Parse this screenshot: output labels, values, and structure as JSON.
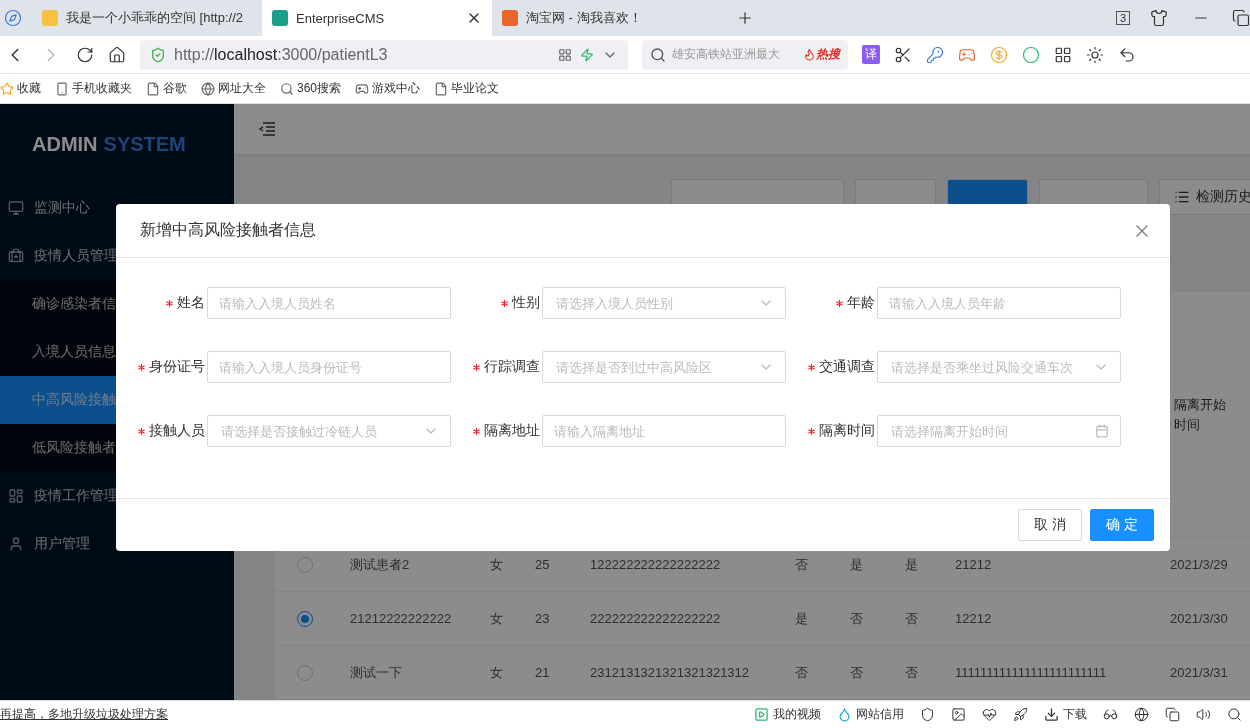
{
  "browser": {
    "tabs": [
      {
        "title": "我是一个小乖乖的空间 [http://2",
        "selected": false
      },
      {
        "title": "EnterpriseCMS",
        "selected": true
      },
      {
        "title": "淘宝网 - 淘我喜欢！",
        "selected": false
      }
    ],
    "tab_count": "3",
    "url_prefix": "http://",
    "url_host": "localhost",
    "url_rest": ":3000/patientL3",
    "search_placeholder": "雄安高铁站亚洲最大",
    "hot_search": "热搜",
    "translate": "译",
    "bookmarks": [
      "收藏",
      "手机收藏夹",
      "谷歌",
      "网址大全",
      "360搜索",
      "游戏中心",
      "毕业论文"
    ]
  },
  "app": {
    "brand": {
      "first": "ADMIN",
      "second": "SYSTEM"
    },
    "sidebar": [
      {
        "label": "监测中心",
        "selected": false
      },
      {
        "label": "疫情人员管理",
        "selected": false,
        "children": [
          {
            "label": "确诊感染者信",
            "selected": false
          },
          {
            "label": "入境人员信息",
            "selected": false
          },
          {
            "label": "中高风险接触",
            "selected": true
          },
          {
            "label": "低风险接触者",
            "selected": false
          }
        ]
      },
      {
        "label": "疫情工作管理",
        "selected": false
      },
      {
        "label": "用户管理",
        "selected": false
      }
    ],
    "history_button": "检测历史",
    "table": {
      "last_header": "隔离开始时间",
      "rows": [
        {
          "selected": false,
          "cells": [
            "测试患者2",
            "女",
            "25",
            "122222222222222222",
            "否",
            "是",
            "是",
            "21212",
            "2021/3/29"
          ]
        },
        {
          "selected": true,
          "cells": [
            "21212222222222",
            "女",
            "23",
            "222222222222222222",
            "是",
            "否",
            "否",
            "12212",
            "2021/3/30"
          ]
        },
        {
          "selected": false,
          "cells": [
            "测试一下",
            "女",
            "21",
            "2312131321321321321312",
            "否",
            "否",
            "否",
            "111111111111111111111111",
            "2021/3/31"
          ]
        }
      ]
    }
  },
  "dialog": {
    "title": "新增中高风险接触者信息",
    "fields": [
      {
        "label": "姓名",
        "required": true,
        "kind": "input",
        "placeholder": "请输入入境人员姓名"
      },
      {
        "label": "性别",
        "required": true,
        "kind": "select",
        "placeholder": "请选择入境人员性别"
      },
      {
        "label": "年龄",
        "required": true,
        "kind": "input",
        "placeholder": "请输入入境人员年龄"
      },
      {
        "label": "身份证号",
        "required": true,
        "kind": "input",
        "placeholder": "请输入入境人员身份证号"
      },
      {
        "label": "行踪调查",
        "required": true,
        "kind": "select",
        "placeholder": "请选择是否到过中高风险区"
      },
      {
        "label": "交通调查",
        "required": true,
        "kind": "select",
        "placeholder": "请选择是否乘坐过风险交通车次"
      },
      {
        "label": "接触人员",
        "required": true,
        "kind": "select",
        "placeholder": "请选择是否接触过冷链人员"
      },
      {
        "label": "隔离地址",
        "required": true,
        "kind": "input",
        "placeholder": "请输入隔离地址"
      },
      {
        "label": "隔离时间",
        "required": true,
        "kind": "date",
        "placeholder": "请选择隔离开始时间"
      }
    ],
    "cancel": "取 消",
    "confirm": "确 定"
  },
  "status_bar": {
    "news": "再提高，多地升级垃圾处理方案",
    "video": "我的视频",
    "credit": "网站信用",
    "download": "下载"
  }
}
